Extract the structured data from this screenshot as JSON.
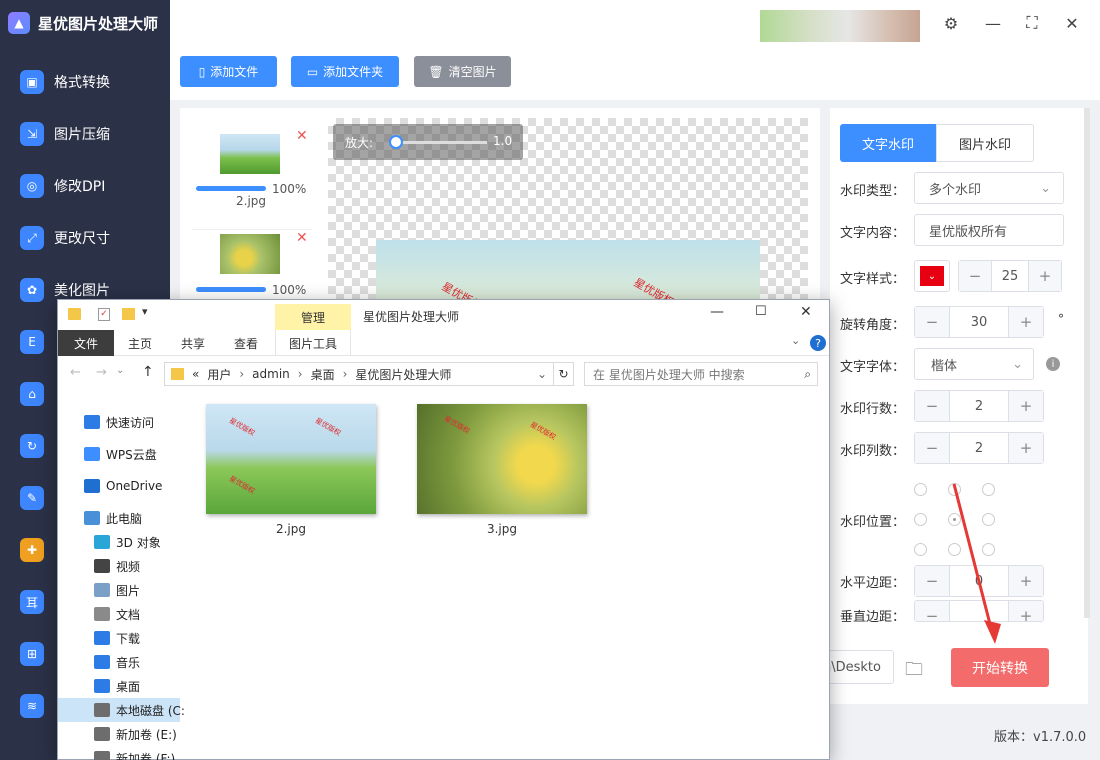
{
  "app": {
    "title": "星优图片处理大师",
    "version_label": "版本：v1.7.0.0"
  },
  "sidebar": {
    "items": [
      {
        "label": "格式转换",
        "icon": "image-convert-icon"
      },
      {
        "label": "图片压缩",
        "icon": "compress-icon"
      },
      {
        "label": "修改DPI",
        "icon": "dpi-icon"
      },
      {
        "label": "更改尺寸",
        "icon": "resize-icon"
      },
      {
        "label": "美化图片",
        "icon": "beautify-icon"
      }
    ]
  },
  "toolbar": {
    "add_file": "添加文件",
    "add_folder": "添加文件夹",
    "clear": "清空图片"
  },
  "colors": {
    "primary": "#3d8eff",
    "sidebar": "#2b3147",
    "start_button": "#f36b6b",
    "gray_button": "#8b8f99"
  },
  "file_list": [
    {
      "name": "2.jpg",
      "progress": "100%"
    },
    {
      "name": "3.jpg",
      "progress": "100%"
    }
  ],
  "preview": {
    "zoom_label": "放大:",
    "zoom_value": "1.0",
    "watermark_text": "星优版权"
  },
  "settings": {
    "tabs": [
      "文字水印",
      "图片水印"
    ],
    "type_label": "水印类型：",
    "type_value": "多个水印",
    "content_label": "文字内容：",
    "content_value": "星优版权所有",
    "style_label": "文字样式：",
    "font_size": "25",
    "text_color": "#e60012",
    "rotation_label": "旋转角度：",
    "rotation": "30",
    "degree_unit": "°",
    "font_label": "文字字体：",
    "font_value": "楷体",
    "rows_label": "水印行数：",
    "rows": "2",
    "cols_label": "水印列数：",
    "cols": "2",
    "position_label": "水印位置：",
    "hmargin_label": "水平边距：",
    "hmargin": "0",
    "vmargin_label": "垂直边距："
  },
  "output": {
    "path_value": "n\\Deskto",
    "start_button": "开始转换"
  },
  "explorer": {
    "title": "星优图片处理大师",
    "manage_tab": "管理",
    "ribbon": {
      "file": "文件",
      "home": "主页",
      "share": "共享",
      "view": "查看",
      "tools": "图片工具"
    },
    "breadcrumb": {
      "prefix": "«",
      "parts": [
        "用户",
        "admin",
        "桌面",
        "星优图片处理大师"
      ]
    },
    "search_placeholder": "在 星优图片处理大师 中搜索",
    "nav": [
      "快速访问",
      "WPS云盘",
      "OneDrive",
      "此电脑",
      "3D 对象",
      "视频",
      "图片",
      "文档",
      "下载",
      "音乐",
      "桌面",
      "本地磁盘 (C:",
      "新加卷 (E:)",
      "新加卷 (F:)"
    ],
    "files": [
      {
        "name": "2.jpg"
      },
      {
        "name": "3.jpg"
      }
    ]
  }
}
